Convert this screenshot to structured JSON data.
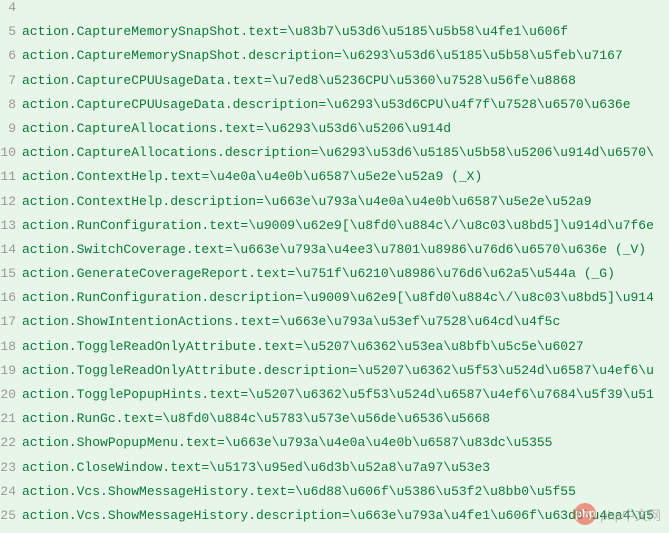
{
  "lines": [
    {
      "num": "4",
      "text": ""
    },
    {
      "num": "5",
      "text": "action.CaptureMemorySnapShot.text=\\u83b7\\u53d6\\u5185\\u5b58\\u4fe1\\u606f"
    },
    {
      "num": "6",
      "text": "action.CaptureMemorySnapShot.description=\\u6293\\u53d6\\u5185\\u5b58\\u5feb\\u7167"
    },
    {
      "num": "7",
      "text": "action.CaptureCPUUsageData.text=\\u7ed8\\u5236CPU\\u5360\\u7528\\u56fe\\u8868"
    },
    {
      "num": "8",
      "text": "action.CaptureCPUUsageData.description=\\u6293\\u53d6CPU\\u4f7f\\u7528\\u6570\\u636e"
    },
    {
      "num": "9",
      "text": "action.CaptureAllocations.text=\\u6293\\u53d6\\u5206\\u914d"
    },
    {
      "num": "10",
      "text": "action.CaptureAllocations.description=\\u6293\\u53d6\\u5185\\u5b58\\u5206\\u914d\\u6570\\"
    },
    {
      "num": "11",
      "text": "action.ContextHelp.text=\\u4e0a\\u4e0b\\u6587\\u5e2e\\u52a9 (_X)"
    },
    {
      "num": "12",
      "text": "action.ContextHelp.description=\\u663e\\u793a\\u4e0a\\u4e0b\\u6587\\u5e2e\\u52a9"
    },
    {
      "num": "13",
      "text": "action.RunConfiguration.text=\\u9009\\u62e9[\\u8fd0\\u884c\\/\\u8c03\\u8bd5]\\u914d\\u7f6e"
    },
    {
      "num": "14",
      "text": "action.SwitchCoverage.text=\\u663e\\u793a\\u4ee3\\u7801\\u8986\\u76d6\\u6570\\u636e (_V)"
    },
    {
      "num": "15",
      "text": "action.GenerateCoverageReport.text=\\u751f\\u6210\\u8986\\u76d6\\u62a5\\u544a (_G)"
    },
    {
      "num": "16",
      "text": "action.RunConfiguration.description=\\u9009\\u62e9[\\u8fd0\\u884c\\/\\u8c03\\u8bd5]\\u914"
    },
    {
      "num": "17",
      "text": "action.ShowIntentionActions.text=\\u663e\\u793a\\u53ef\\u7528\\u64cd\\u4f5c"
    },
    {
      "num": "18",
      "text": "action.ToggleReadOnlyAttribute.text=\\u5207\\u6362\\u53ea\\u8bfb\\u5c5e\\u6027"
    },
    {
      "num": "19",
      "text": "action.ToggleReadOnlyAttribute.description=\\u5207\\u6362\\u5f53\\u524d\\u6587\\u4ef6\\u"
    },
    {
      "num": "20",
      "text": "action.TogglePopupHints.text=\\u5207\\u6362\\u5f53\\u524d\\u6587\\u4ef6\\u7684\\u5f39\\u51"
    },
    {
      "num": "21",
      "text": "action.RunGc.text=\\u8fd0\\u884c\\u5783\\u573e\\u56de\\u6536\\u5668"
    },
    {
      "num": "22",
      "text": "action.ShowPopupMenu.text=\\u663e\\u793a\\u4e0a\\u4e0b\\u6587\\u83dc\\u5355"
    },
    {
      "num": "23",
      "text": "action.CloseWindow.text=\\u5173\\u95ed\\u6d3b\\u52a8\\u7a97\\u53e3"
    },
    {
      "num": "24",
      "text": "action.Vcs.ShowMessageHistory.text=\\u6d88\\u606f\\u5386\\u53f2\\u8bb0\\u5f55"
    },
    {
      "num": "25",
      "text": "action.Vcs.ShowMessageHistory.description=\\u663e\\u793a\\u4fe1\\u606f\\u63d0\\u4ea4\\u5"
    }
  ],
  "watermark": {
    "logo": "php",
    "text": "php中文网"
  }
}
